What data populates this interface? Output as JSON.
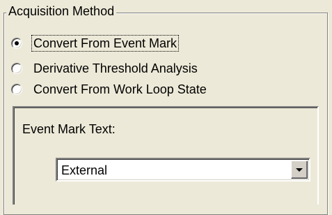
{
  "group": {
    "title": "Acquisition Method"
  },
  "radios": [
    {
      "label": "Convert From Event Mark",
      "checked": true
    },
    {
      "label": "Derivative Threshold Analysis",
      "checked": false
    },
    {
      "label": "Convert From Work Loop State",
      "checked": false
    }
  ],
  "panel": {
    "label": "Event Mark Text:"
  },
  "combo": {
    "value": "External"
  }
}
